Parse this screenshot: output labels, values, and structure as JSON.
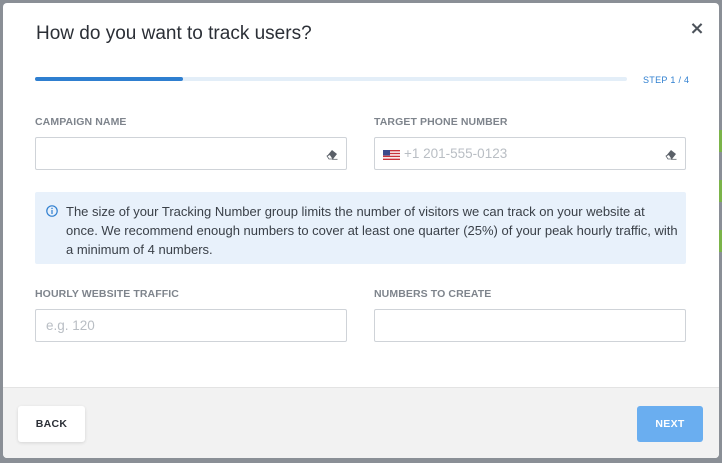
{
  "modal": {
    "title": "How do you want to track users?",
    "close_glyph": "×",
    "step_label": "STEP 1 / 4",
    "progress_fraction": 0.25
  },
  "form": {
    "campaign_name": {
      "label": "CAMPAIGN NAME",
      "value": "",
      "placeholder": ""
    },
    "target_phone": {
      "label": "TARGET PHONE NUMBER",
      "value": "",
      "placeholder": "+1 201-555-0123",
      "flag": "us-flag-icon"
    },
    "hourly_traffic": {
      "label": "HOURLY WEBSITE TRAFFIC",
      "value": "",
      "placeholder": "e.g. 120"
    },
    "numbers_to_create": {
      "label": "NUMBERS TO CREATE",
      "value": "",
      "placeholder": ""
    }
  },
  "info": {
    "text": "The size of your Tracking Number group limits the number of visitors we can track on your website at once. We recommend enough numbers to cover at least one quarter (25%) of your peak hourly traffic, with a minimum of 4 numbers.",
    "icon": "info-icon"
  },
  "footer": {
    "back_label": "BACK",
    "next_label": "NEXT"
  },
  "colors": {
    "accent": "#2f7fd0",
    "next_button": "#6aaef0",
    "info_background": "#e8f1fb",
    "backdrop": "#8a8f96"
  }
}
